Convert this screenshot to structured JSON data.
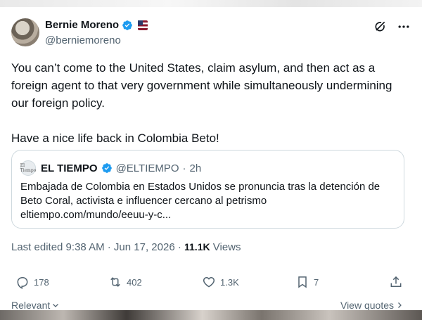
{
  "author": {
    "name": "Bernie Moreno",
    "handle": "@berniemoreno"
  },
  "tweet": {
    "paragraph1": "You can’t come to the United States, claim asylum, and then act as a foreign agent to that very government while simultaneously undermining our foreign policy.",
    "paragraph2": "Have a nice life back in Colombia Beto!"
  },
  "quoted": {
    "avatar_text": "El Tiempo",
    "name": "EL TIEMPO",
    "handle": "@ELTIEMPO",
    "separator": "·",
    "time": "2h",
    "text": "Embajada de Colombia en Estados Unidos se pronuncia tras la detención de Beto Coral, activista e influencer cercano al petrismo",
    "link": "eltiempo.com/mundo/eeuu-y-c..."
  },
  "meta": {
    "edited": "Last edited 9:38 AM · Jun 17, 2026 ·",
    "views_count": "11.1K",
    "views_label": "Views"
  },
  "stats": {
    "replies": "178",
    "reposts": "402",
    "likes": "1.3K",
    "bookmarks": "7"
  },
  "footer": {
    "relevant": "Relevant",
    "view_quotes": "View quotes"
  },
  "colors": {
    "verified_blue": "#1d9bf0",
    "secondary_text": "#536471",
    "primary_text": "#0f1419"
  }
}
